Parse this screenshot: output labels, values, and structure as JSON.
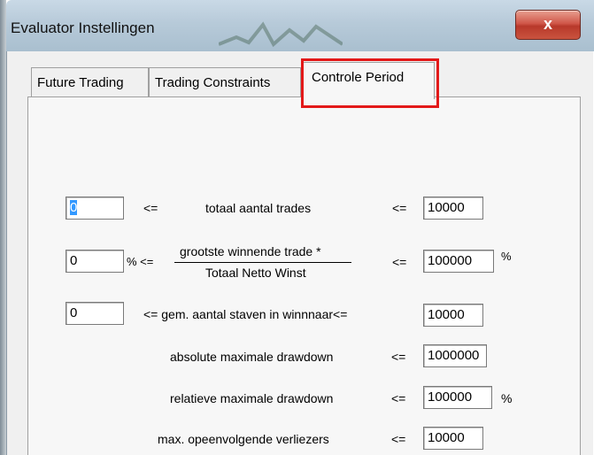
{
  "window": {
    "title": "Evaluator Instellingen",
    "close_glyph": "x",
    "close_icon": "close-icon"
  },
  "tabs": [
    {
      "label": "Future Trading"
    },
    {
      "label": "Trading Constraints"
    },
    {
      "label": "Controle Period",
      "active": true,
      "highlighted": true,
      "highlight_color": "#e31919"
    }
  ],
  "constraints": {
    "trades": {
      "min": "0",
      "lte_left": "<=",
      "label": "totaal aantal trades",
      "lte_right": "<=",
      "max": "10000"
    },
    "winner_ratio": {
      "min": "0",
      "pct_left": "% <=",
      "numerator": "grootste winnende trade *",
      "denominator": "Totaal Netto Winst",
      "lte_right": "<=",
      "max": "100000",
      "pct_right": "%"
    },
    "bars_winner": {
      "min": "0",
      "label": "<= gem. aantal staven in winnnaar<=",
      "max": "10000"
    },
    "abs_drawdown": {
      "label": "absolute maximale drawdown",
      "lte": "<=",
      "max": "1000000"
    },
    "rel_drawdown": {
      "label": "relatieve maximale drawdown",
      "lte": "<=",
      "max": "100000",
      "pct": "%"
    },
    "consec_losers": {
      "label": "max. opeenvolgende verliezers",
      "lte": "<=",
      "max": "10000"
    }
  }
}
